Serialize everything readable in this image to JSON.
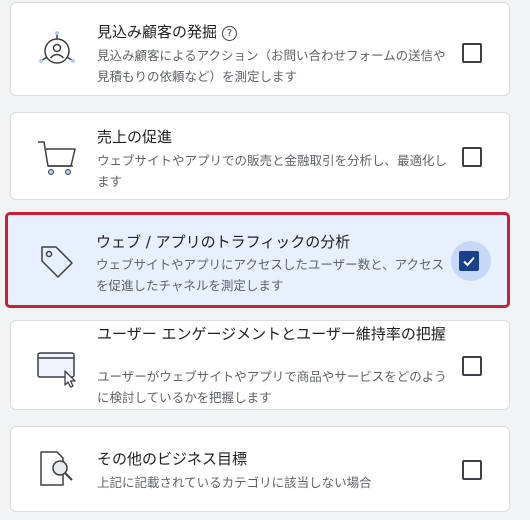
{
  "objectives": [
    {
      "title": "見込み顧客の発掘",
      "help_icon": "?",
      "description": "見込み顧客によるアクション（お問い合わせフォームの送信や見積もりの依頼など）を測定します",
      "icon": "lead-target-icon",
      "checked": false
    },
    {
      "title": "売上の促進",
      "description": "ウェブサイトやアプリでの販売と金融取引を分析し、最適化します",
      "icon": "shopping-cart-icon",
      "checked": false
    },
    {
      "title": "ウェブ / アプリのトラフィックの分析",
      "description": "ウェブサイトやアプリにアクセスしたユーザー数と、アクセスを促進したチャネルを測定します",
      "icon": "tag-icon",
      "checked": true
    },
    {
      "title": "ユーザー エンゲージメントとユーザー維持率の把握",
      "description": "ユーザーがウェブサイトやアプリで商品やサービスをどのように検討しているかを把握します",
      "icon": "browser-cursor-icon",
      "checked": false
    },
    {
      "title": "その他のビジネス目標",
      "description": "上記に記載されているカテゴリに該当しない場合",
      "icon": "document-search-icon",
      "checked": false
    }
  ],
  "colors": {
    "selected_border": "#c5223a",
    "selected_background": "#e8f0fe",
    "checkbox_checked": "#1a3f8f"
  }
}
